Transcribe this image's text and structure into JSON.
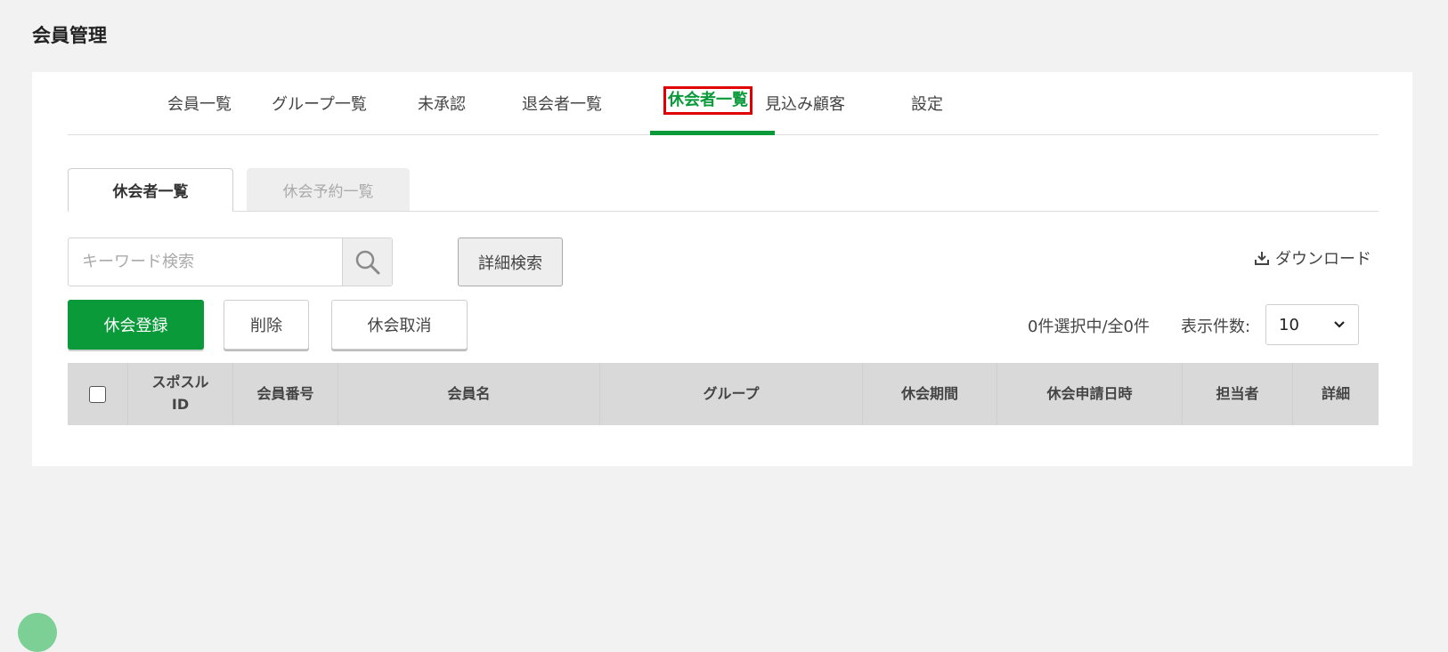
{
  "page": {
    "title": "会員管理"
  },
  "main_tabs": [
    {
      "label": "会員一覧"
    },
    {
      "label": "グループ一覧"
    },
    {
      "label": "未承認"
    },
    {
      "label": "退会者一覧"
    },
    {
      "label": "休会者一覧",
      "active": true
    },
    {
      "label": "見込み顧客"
    },
    {
      "label": "設定"
    }
  ],
  "sub_tabs": [
    {
      "label": "休会者一覧",
      "active": true
    },
    {
      "label": "休会予約一覧"
    }
  ],
  "search": {
    "placeholder": "キーワード検索",
    "detail_button": "詳細検索"
  },
  "download_label": "ダウンロード",
  "actions": {
    "register": "休会登録",
    "delete": "削除",
    "cancel": "休会取消"
  },
  "selection_info": "0件選択中/全0件",
  "per_page": {
    "label": "表示件数:",
    "value": "10"
  },
  "table": {
    "headers": [
      "スポスル\nID",
      "会員番号",
      "会員名",
      "グループ",
      "休会期間",
      "休会申請日時",
      "担当者",
      "詳細"
    ]
  },
  "colors": {
    "accent": "#0a9a3a",
    "highlight": "#e00000"
  }
}
